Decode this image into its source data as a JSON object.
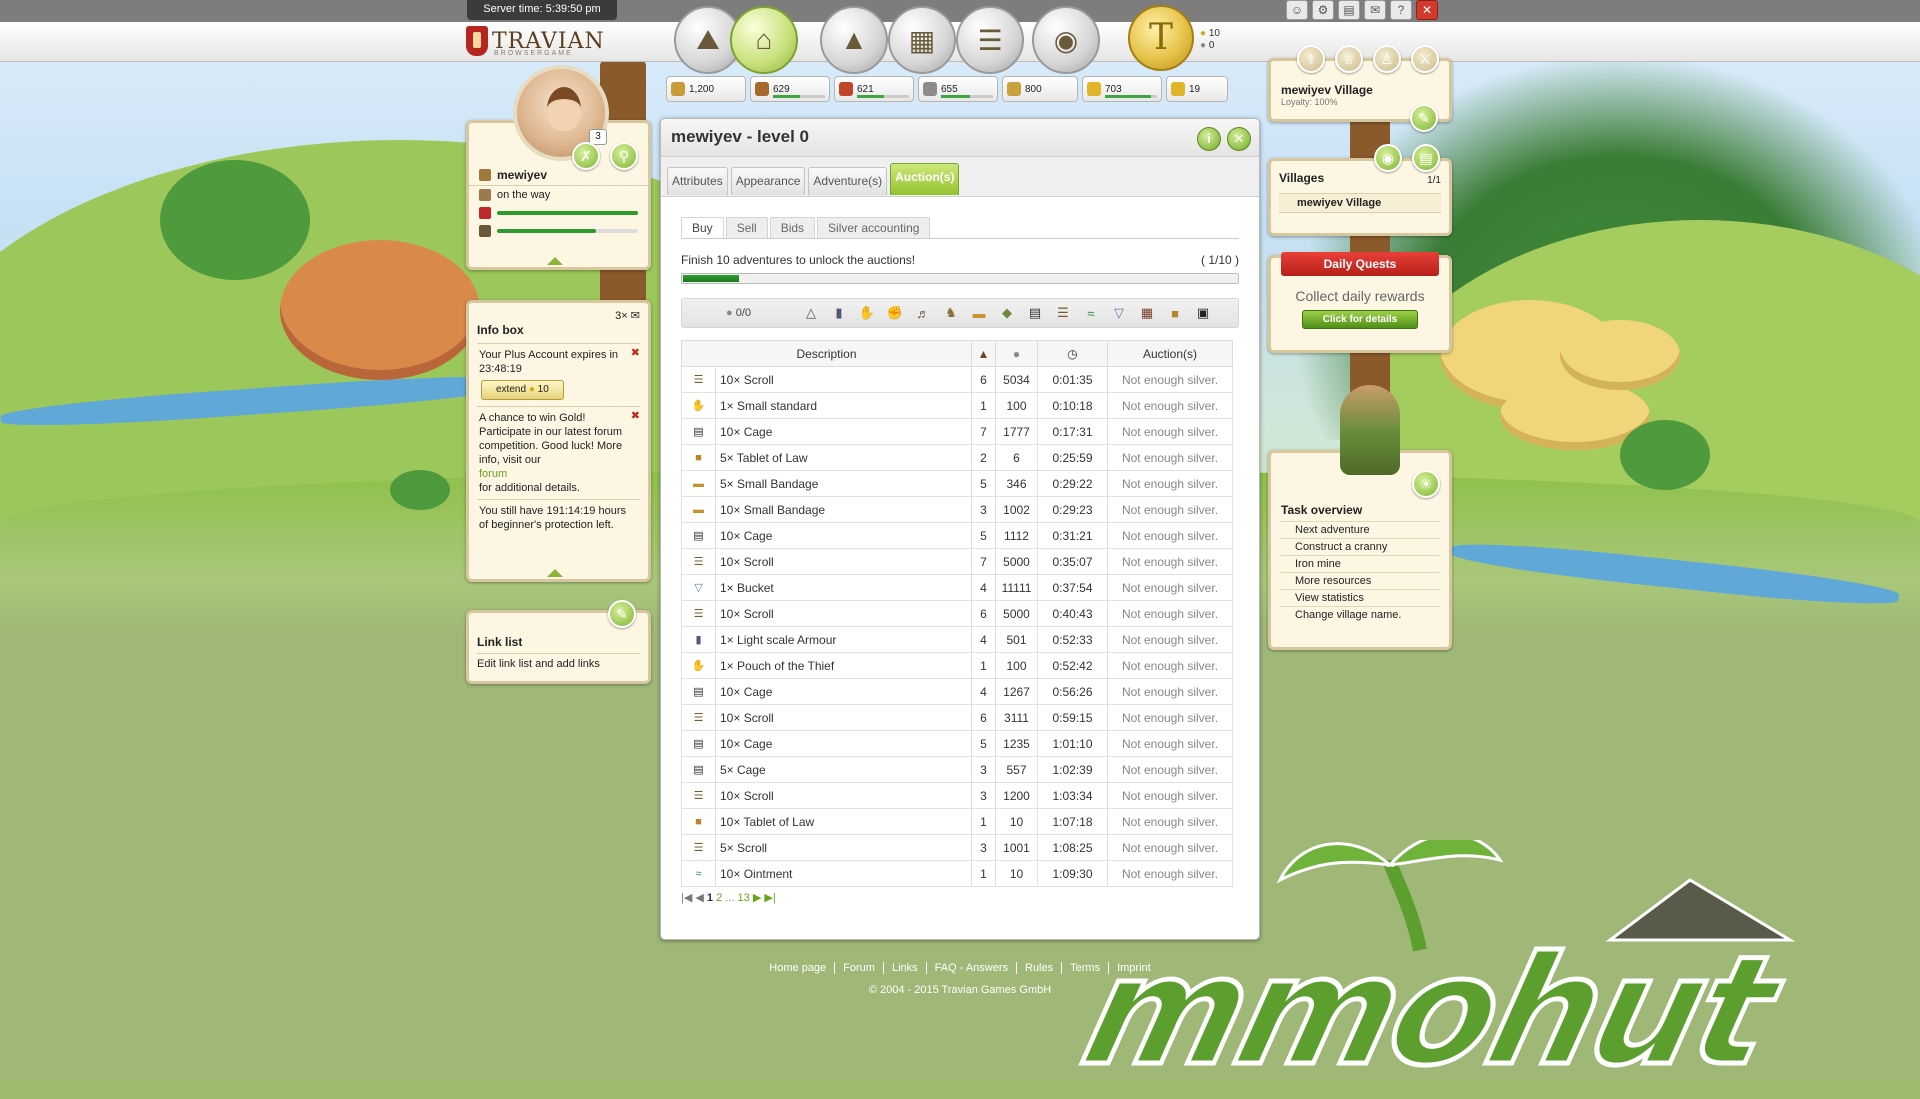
{
  "server_time": {
    "label": "Server time:",
    "value": "5:39:50 pm"
  },
  "logo": {
    "name": "TRAVIAN",
    "sub": "BROWSERGAME"
  },
  "gold": {
    "amount": "10",
    "silver": "0"
  },
  "resources": [
    {
      "name": "warehouse",
      "value": "1,200",
      "color": "#c89c3a",
      "fill": 0
    },
    {
      "name": "wood",
      "value": "629",
      "color": "#a86a2a",
      "fill": 0.52
    },
    {
      "name": "clay",
      "value": "621",
      "color": "#c0452a",
      "fill": 0.52
    },
    {
      "name": "iron",
      "value": "655",
      "color": "#8c8c8c",
      "fill": 0.55
    },
    {
      "name": "granary",
      "value": "800",
      "color": "#c8a23a",
      "fill": 0
    },
    {
      "name": "crop",
      "value": "703",
      "color": "#e1b52a",
      "fill": 0.88
    },
    {
      "name": "crop-balance",
      "value": "19",
      "color": "#e1b52a",
      "fill": 0
    }
  ],
  "hero": {
    "name": "mewiyev",
    "status": "on the way",
    "level": "3",
    "health": 1.0,
    "experience": 0.7
  },
  "info_box": {
    "title": "Info box",
    "count": "3×",
    "entry1": "Your Plus Account expires in 23:48:19",
    "extend_label": "extend",
    "extend_cost": "10",
    "entry2": "A chance to win Gold! Participate in our latest forum competition. Good luck! More info, visit our",
    "entry2_link": "forum",
    "entry2_tail": "for additional details.",
    "entry3": "You still have 191:14:19 hours of beginner's protection left."
  },
  "link_list": {
    "title": "Link list",
    "text": "Edit link list and add links"
  },
  "window": {
    "title": "mewiyev - level 0",
    "tabs": [
      "Attributes",
      "Appearance",
      "Adventure(s)",
      "Auction(s)"
    ],
    "subtabs": [
      "Buy",
      "Sell",
      "Bids",
      "Silver accounting"
    ],
    "unlock_text": "Finish 10 adventures to unlock the auctions!",
    "unlock_count": "( 1/10 )",
    "unlock_progress": 0.1,
    "silver_filter": "0/0",
    "columns": {
      "description": "Description",
      "auctions": "Auction(s)"
    },
    "rows": [
      {
        "icon": "scroll",
        "desc": "10× Scroll",
        "bids": "6",
        "price": "5034",
        "time": "0:01:35",
        "status": "Not enough silver."
      },
      {
        "icon": "small-standard",
        "desc": "1× Small standard",
        "bids": "1",
        "price": "100",
        "time": "0:10:18",
        "status": "Not enough silver."
      },
      {
        "icon": "cage",
        "desc": "10× Cage",
        "bids": "7",
        "price": "1777",
        "time": "0:17:31",
        "status": "Not enough silver."
      },
      {
        "icon": "tablet-of-law",
        "desc": "5× Tablet of Law",
        "bids": "2",
        "price": "6",
        "time": "0:25:59",
        "status": "Not enough silver."
      },
      {
        "icon": "bandage",
        "desc": "5× Small Bandage",
        "bids": "5",
        "price": "346",
        "time": "0:29:22",
        "status": "Not enough silver."
      },
      {
        "icon": "bandage",
        "desc": "10× Small Bandage",
        "bids": "3",
        "price": "1002",
        "time": "0:29:23",
        "status": "Not enough silver."
      },
      {
        "icon": "cage",
        "desc": "10× Cage",
        "bids": "5",
        "price": "1112",
        "time": "0:31:21",
        "status": "Not enough silver."
      },
      {
        "icon": "scroll",
        "desc": "10× Scroll",
        "bids": "7",
        "price": "5000",
        "time": "0:35:07",
        "status": "Not enough silver."
      },
      {
        "icon": "bucket",
        "desc": "1× Bucket",
        "bids": "4",
        "price": "11111",
        "time": "0:37:54",
        "status": "Not enough silver."
      },
      {
        "icon": "scroll",
        "desc": "10× Scroll",
        "bids": "6",
        "price": "5000",
        "time": "0:40:43",
        "status": "Not enough silver."
      },
      {
        "icon": "armour",
        "desc": "1× Light scale Armour",
        "bids": "4",
        "price": "501",
        "time": "0:52:33",
        "status": "Not enough silver."
      },
      {
        "icon": "pouch",
        "desc": "1× Pouch of the Thief",
        "bids": "1",
        "price": "100",
        "time": "0:52:42",
        "status": "Not enough silver."
      },
      {
        "icon": "cage",
        "desc": "10× Cage",
        "bids": "4",
        "price": "1267",
        "time": "0:56:26",
        "status": "Not enough silver."
      },
      {
        "icon": "scroll",
        "desc": "10× Scroll",
        "bids": "6",
        "price": "3111",
        "time": "0:59:15",
        "status": "Not enough silver."
      },
      {
        "icon": "cage",
        "desc": "10× Cage",
        "bids": "5",
        "price": "1235",
        "time": "1:01:10",
        "status": "Not enough silver."
      },
      {
        "icon": "cage",
        "desc": "5× Cage",
        "bids": "3",
        "price": "557",
        "time": "1:02:39",
        "status": "Not enough silver."
      },
      {
        "icon": "scroll",
        "desc": "10× Scroll",
        "bids": "3",
        "price": "1200",
        "time": "1:03:34",
        "status": "Not enough silver."
      },
      {
        "icon": "tablet-of-law",
        "desc": "10× Tablet of Law",
        "bids": "1",
        "price": "10",
        "time": "1:07:18",
        "status": "Not enough silver."
      },
      {
        "icon": "scroll",
        "desc": "5× Scroll",
        "bids": "3",
        "price": "1001",
        "time": "1:08:25",
        "status": "Not enough silver."
      },
      {
        "icon": "ointment",
        "desc": "10× Ointment",
        "bids": "1",
        "price": "10",
        "time": "1:09:30",
        "status": "Not enough silver."
      }
    ],
    "pager": {
      "current": "1",
      "next": "2",
      "ellipsis": "...",
      "last": "13"
    }
  },
  "village": {
    "name": "mewiyev Village",
    "loyalty": "Loyalty: 100%"
  },
  "villages": {
    "title": "Villages",
    "count": "1/1",
    "item": "mewiyev Village"
  },
  "daily_quests": {
    "title": "Daily Quests",
    "text": "Collect daily rewards",
    "button": "Click for details"
  },
  "tasks": {
    "title": "Task overview",
    "items": [
      "Next adventure",
      "Construct a cranny",
      "Iron mine",
      "More resources",
      "View statistics",
      "Change village name."
    ]
  },
  "footer": {
    "links": [
      "Home page",
      "Forum",
      "Links",
      "FAQ - Answers",
      "Rules",
      "Terms",
      "Imprint"
    ],
    "copyright": "© 2004 - 2015 Travian Games GmbH"
  },
  "watermark": "mmohut"
}
